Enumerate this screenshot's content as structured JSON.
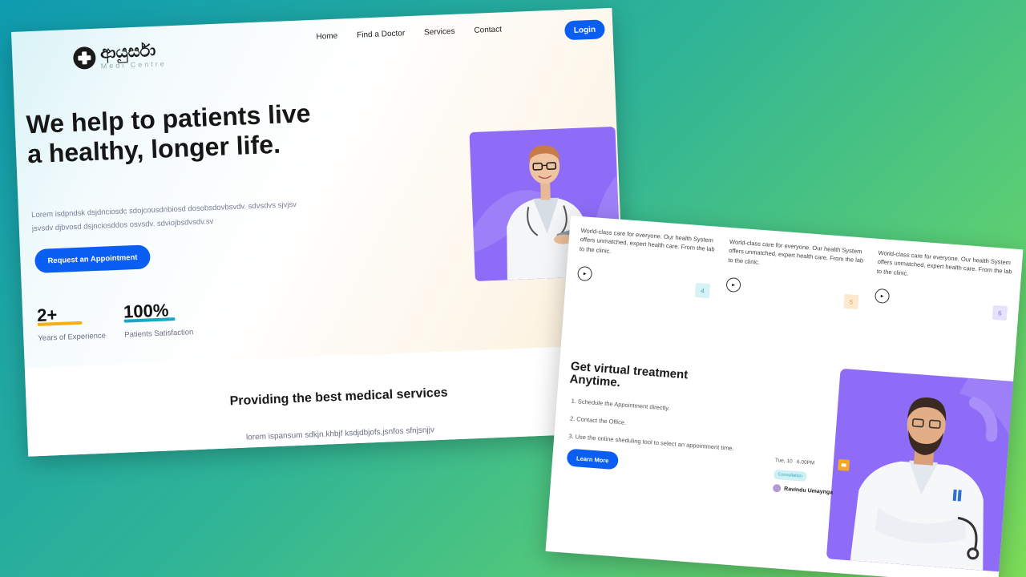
{
  "shot1": {
    "logo": {
      "main": "ආයුර්සා",
      "sub": "Medi Centre"
    },
    "nav": [
      "Home",
      "Find a Doctor",
      "Services",
      "Contact"
    ],
    "login": "Login",
    "hero": {
      "title": "We help to patients live a healthy, longer life.",
      "desc": "Lorem isdpndsk dsjdnciosdc sdojcousdnbiosd dosobsdovbsvdv. sdvsdvs sjvjsv jsvsdv djbvosd dsjnciosddos osvsdv. sdviojbsdvsdv.sv",
      "cta": "Request an Appointment"
    },
    "stats": [
      {
        "value": "2+",
        "label": "Years of Experience",
        "color": "#f5b016"
      },
      {
        "value": "100%",
        "label": "Patients Satisfaction",
        "color": "#1aa7c4"
      }
    ],
    "services": {
      "title": "Providing the best medical services",
      "desc": "lorem ispansum sdkjn.khbjf ksdjdbjofs,jsnfos sfnjsnjjv"
    }
  },
  "shot2": {
    "features": [
      {
        "text": "World-class care for everyone. Our health System offers unmatched, expert health care. From the lab to the clinic.",
        "num": "4",
        "bg": "#d6f2f5",
        "fg": "#3ba5b7"
      },
      {
        "text": "World-class care for everyone. Our health System offers unmatched, expert health care. From the lab to the clinic.",
        "num": "5",
        "bg": "#fde9cf",
        "fg": "#e4a55a"
      },
      {
        "text": "World-class care for everyone. Our health System offers unmatched, expert health care. From the lab to the clinic.",
        "num": "6",
        "bg": "#e7e2fb",
        "fg": "#8e6cf7"
      }
    ],
    "virtual": {
      "title_line1": "Get virtual treatment",
      "title_line2": "Anytime.",
      "steps": [
        "1. Schedule the Appointment directly.",
        "2. Contact the Office.",
        "3. Use the online sheduling tool to select an appointment time."
      ],
      "cta": "Learn More"
    },
    "schedule": {
      "date": "Tue, 10",
      "time": "6.00PM",
      "badge": "Consultation",
      "doctor": "Ravindu Umaynga"
    }
  }
}
